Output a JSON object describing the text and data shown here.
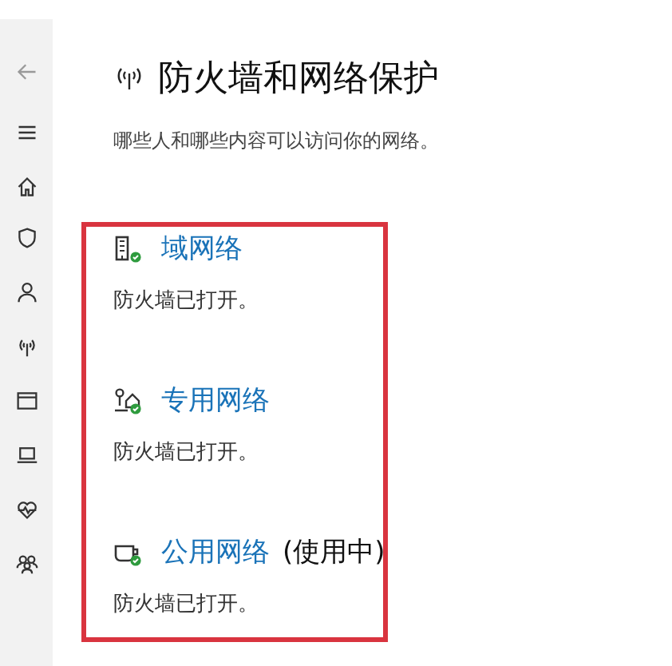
{
  "sidebar": {
    "items": [
      {
        "kind": "back"
      },
      {
        "kind": "menu"
      },
      {
        "kind": "home"
      },
      {
        "kind": "shield"
      },
      {
        "kind": "account"
      },
      {
        "kind": "network"
      },
      {
        "kind": "app"
      },
      {
        "kind": "device"
      },
      {
        "kind": "health"
      },
      {
        "kind": "family"
      }
    ]
  },
  "page": {
    "title": "防火墙和网络保护",
    "subtitle": "哪些人和哪些内容可以访问你的网络。"
  },
  "networks": [
    {
      "kind": "domain",
      "name": "域网络",
      "status": "防火墙已打开。"
    },
    {
      "kind": "private",
      "name": "专用网络",
      "status": "防火墙已打开。"
    },
    {
      "kind": "public",
      "name": "公用网络",
      "note": "(使用中)",
      "status": "防火墙已打开。"
    }
  ],
  "highlight": {
    "color": "#d9343f"
  }
}
